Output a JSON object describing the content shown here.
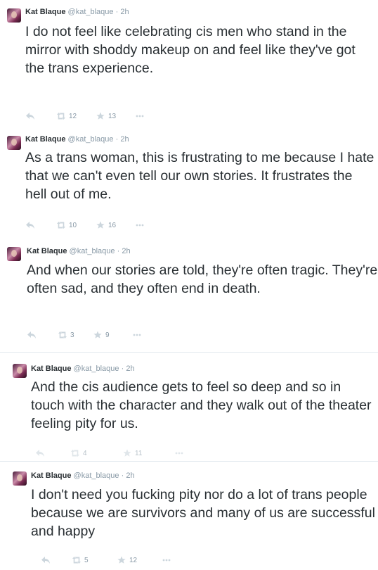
{
  "tweets": [
    {
      "name": "Kat Blaque",
      "handle": "@kat_blaque",
      "dot": "·",
      "time": "2h",
      "text": "I do not feel like celebrating cis men who stand in the mirror with shoddy makeup on and feel like they've got the trans experience.",
      "retweets": "12",
      "favorites": "13",
      "icons": {
        "reply": "reply-icon",
        "retweet": "retweet-icon",
        "favorite": "star-icon",
        "more": "more-icon"
      }
    },
    {
      "name": "Kat Blaque",
      "handle": "@kat_blaque",
      "dot": "·",
      "time": "2h",
      "text": "As a trans woman, this is frustrating to me because I hate that we can't even tell our own stories. It frustrates the hell out of me.",
      "retweets": "10",
      "favorites": "16"
    },
    {
      "name": "Kat Blaque",
      "handle": "@kat_blaque",
      "dot": "·",
      "time": "2h",
      "text": "And when our stories are told, they're often tragic. They're often sad, and they often end in death.",
      "retweets": "3",
      "favorites": "9"
    },
    {
      "name": "Kat Blaque",
      "handle": "@kat_blaque",
      "dot": "·",
      "time": "2h",
      "text": "And the cis audience gets to feel so deep and so in touch with the character and they walk out of the theater feeling pity for us.",
      "retweets": "4",
      "favorites": "11"
    },
    {
      "name": "Kat Blaque",
      "handle": "@kat_blaque",
      "dot": "·",
      "time": "2h",
      "text": "I don't need you fucking pity nor do a lot of trans people because we are survivors and many of us are successful and happy",
      "retweets": "5",
      "favorites": "12"
    }
  ],
  "colors": {
    "text": "#292f33",
    "muted": "#8899a6",
    "border": "#e1e8ed"
  }
}
